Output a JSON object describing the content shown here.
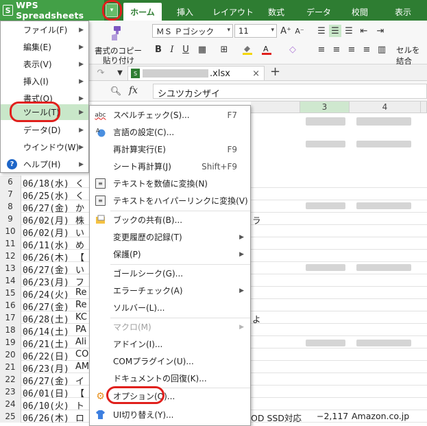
{
  "app": {
    "logo": "S",
    "name": "WPS Spreadsheets",
    "dropdown_glyph": "▾"
  },
  "tabs": [
    {
      "label": "ホーム",
      "active": true
    },
    {
      "label": "挿入"
    },
    {
      "label": "レイアウト"
    },
    {
      "label": "数式"
    },
    {
      "label": "データ"
    },
    {
      "label": "校閲"
    },
    {
      "label": "表示"
    }
  ],
  "ribbon": {
    "format_painter_line1": "書式のコピー",
    "format_painter_line2": "貼り付け",
    "font_name": "ＭＳ Ｐゴシック",
    "font_size": "11",
    "grow_font": "A⁺",
    "shrink_font": "A⁻",
    "bold": "B",
    "italic": "I",
    "underline": "U",
    "merge_cells": "セルを結合"
  },
  "doc_tab": {
    "icon": "S",
    "filename": ".xlsx",
    "close_glyph": "×",
    "add_glyph": "+"
  },
  "formula_bar": {
    "fx": "fx",
    "value": "シユツカシザイ"
  },
  "columns": [
    "3",
    "4"
  ],
  "rows": [
    {
      "num": "6",
      "date": "06/18(水)",
      "text": "く"
    },
    {
      "num": "7",
      "date": "06/25(水)",
      "text": "く"
    },
    {
      "num": "8",
      "date": "06/27(金)",
      "text": "か"
    },
    {
      "num": "9",
      "date": "06/02(月)",
      "text": "株"
    },
    {
      "num": "10",
      "date": "06/02(月)",
      "text": "い"
    },
    {
      "num": "11",
      "date": "06/11(水)",
      "text": "め"
    },
    {
      "num": "12",
      "date": "06/26(木)",
      "text": "【"
    },
    {
      "num": "13",
      "date": "06/27(金)",
      "text": "い"
    },
    {
      "num": "14",
      "date": "06/23(月)",
      "text": "フ"
    },
    {
      "num": "15",
      "date": "06/24(火)",
      "text": "Re"
    },
    {
      "num": "16",
      "date": "06/27(金)",
      "text": "Re"
    },
    {
      "num": "17",
      "date": "06/28(土)",
      "text": "KC"
    },
    {
      "num": "18",
      "date": "06/14(土)",
      "text": "PA"
    },
    {
      "num": "19",
      "date": "06/21(土)",
      "text": "Ali"
    },
    {
      "num": "20",
      "date": "06/22(日)",
      "text": "CO"
    },
    {
      "num": "21",
      "date": "06/23(月)",
      "text": "AM"
    },
    {
      "num": "22",
      "date": "06/27(金)",
      "text": "イ"
    },
    {
      "num": "23",
      "date": "06/01(日)",
      "text": "【"
    },
    {
      "num": "24",
      "date": "06/10(火)",
      "text": "ト"
    },
    {
      "num": "25",
      "date": "06/26(木)",
      "text": "ロ"
    }
  ],
  "row_25_cells": {
    "item": "OD SSD対応",
    "amount": "−2,117",
    "shop": "Amazon.co.jp"
  },
  "grid_fragments": {
    "row_9": "ラ",
    "row_17": "よ"
  },
  "main_menu": [
    {
      "label": "ファイル(F)"
    },
    {
      "label": "編集(E)"
    },
    {
      "label": "表示(V)"
    },
    {
      "label": "挿入(I)"
    },
    {
      "label": "書式(O)"
    },
    {
      "label": "ツール(T)"
    },
    {
      "label": "データ(D)"
    },
    {
      "label": "ウインドウ(W)"
    },
    {
      "label": "ヘルプ(H)"
    }
  ],
  "help_icon_glyph": "?",
  "submenu": {
    "spell": {
      "label": "スペルチェック(S)...",
      "shortcut": "F7",
      "icon": "abc"
    },
    "language": {
      "label": "言語の設定(C)..."
    },
    "recalc": {
      "label": "再計算実行(E)",
      "shortcut": "F9"
    },
    "sheet_recalc": {
      "label": "シート再計算(J)",
      "shortcut": "Shift+F9"
    },
    "text_to_number": {
      "label": "テキストを数値に変換(N)"
    },
    "text_to_hyperlink": {
      "label": "テキストをハイパーリンクに変換(V)"
    },
    "share_book": {
      "label": "ブックの共有(B)..."
    },
    "track_changes": {
      "label": "変更履歴の記録(T)"
    },
    "protect": {
      "label": "保護(P)"
    },
    "goal_seek": {
      "label": "ゴールシーク(G)..."
    },
    "error_check": {
      "label": "エラーチェック(A)"
    },
    "solver": {
      "label": "ソルバー(L)..."
    },
    "macro": {
      "label": "マクロ(M)"
    },
    "addin": {
      "label": "アドイン(I)..."
    },
    "com_plugin": {
      "label": "COMプラグイン(U)..."
    },
    "doc_recovery": {
      "label": "ドキュメントの回復(K)..."
    },
    "options": {
      "label": "オプション(O)..."
    },
    "ui_switch": {
      "label": "UI切り替え(Y)..."
    }
  },
  "colors": {
    "title_green": "#2e7d32",
    "app_green": "#43a047",
    "hover_green": "#c9e7c9",
    "highlight_red": "#e0201c",
    "help_blue": "#1e66c8"
  }
}
